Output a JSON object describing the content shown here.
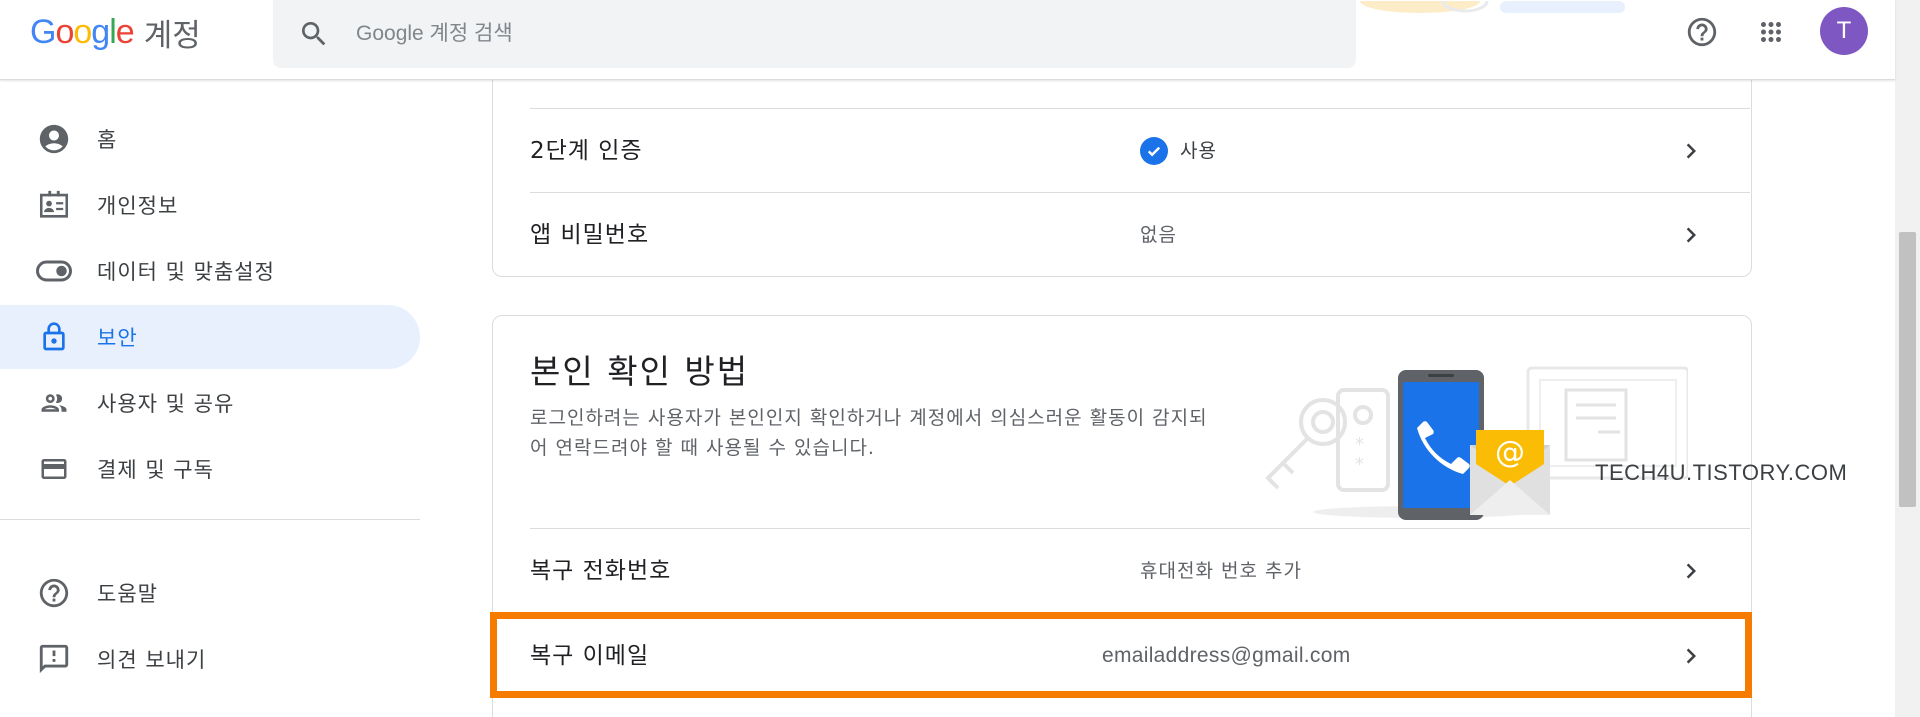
{
  "header": {
    "logo_text": "Google",
    "logo_suffix": "계정",
    "search_placeholder": "Google 계정 검색",
    "avatar_initial": "T"
  },
  "sidebar": {
    "items": [
      {
        "label": "홈",
        "icon": "account-circle-icon"
      },
      {
        "label": "개인정보",
        "icon": "id-card-icon"
      },
      {
        "label": "데이터 및 맞춤설정",
        "icon": "toggle-icon"
      },
      {
        "label": "보안",
        "icon": "lock-icon",
        "active": true
      },
      {
        "label": "사용자 및 공유",
        "icon": "people-icon"
      },
      {
        "label": "결제 및 구독",
        "icon": "credit-card-icon"
      },
      {
        "label": "도움말",
        "icon": "help-circle-icon"
      },
      {
        "label": "의견 보내기",
        "icon": "feedback-icon"
      }
    ]
  },
  "signin_card": {
    "rows": [
      {
        "label": "2단계 인증",
        "value": "사용",
        "status": "checked"
      },
      {
        "label": "앱 비밀번호",
        "value": "없음"
      }
    ]
  },
  "verify_card": {
    "title": "본인 확인 방법",
    "description": "로그인하려는 사용자가 본인인지 확인하거나 계정에서 의심스러운 활동이 감지되어 연락드려야 할 때 사용될 수 있습니다.",
    "rows": [
      {
        "label": "복구 전화번호",
        "value": "휴대전화 번호 추가"
      },
      {
        "label": "복구 이메일",
        "value": "emailaddress@gmail.com"
      }
    ]
  },
  "watermark": "TECH4U.TISTORY.COM",
  "colors": {
    "accent": "#1a73e8",
    "active_bg": "#e8f0fe",
    "highlight": "#f57c00",
    "avatar": "#7e57c2"
  }
}
